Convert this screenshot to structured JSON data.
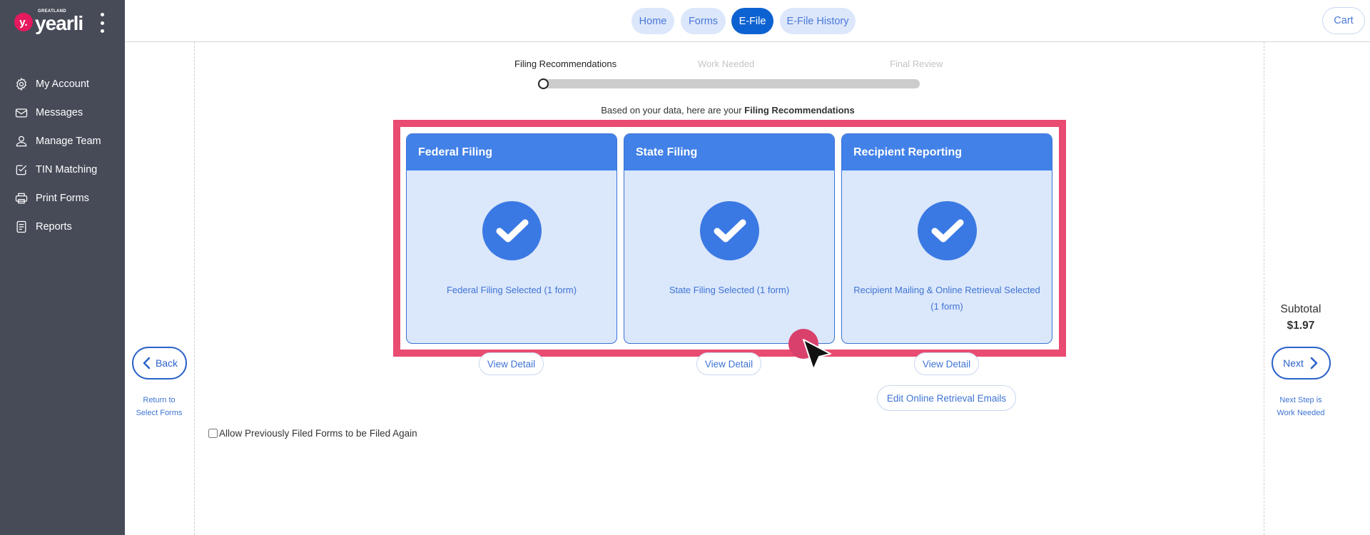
{
  "app": {
    "logo_mark": "y.",
    "logo_brand": "GREATLAND",
    "logo_text": "yearli"
  },
  "sidebar": {
    "items": [
      {
        "label": "My Account",
        "icon": "gear-icon"
      },
      {
        "label": "Messages",
        "icon": "envelope-icon"
      },
      {
        "label": "Manage Team",
        "icon": "user-icon"
      },
      {
        "label": "TIN Matching",
        "icon": "checkbox-icon"
      },
      {
        "label": "Print Forms",
        "icon": "printer-icon"
      },
      {
        "label": "Reports",
        "icon": "document-icon"
      }
    ]
  },
  "header": {
    "tabs": [
      {
        "label": "Home",
        "active": false
      },
      {
        "label": "Forms",
        "active": false
      },
      {
        "label": "E-File",
        "active": true
      },
      {
        "label": "E-File History",
        "active": false
      }
    ],
    "cart_label": "Cart"
  },
  "stepper": {
    "steps": [
      "Filing Recommendations",
      "Work Needed",
      "Final Review"
    ],
    "current_step": 1,
    "step_count": 3
  },
  "intro": {
    "prefix": "Based on your data, here are your ",
    "emphasis": "Filing Recommendations"
  },
  "cards": [
    {
      "title": "Federal Filing",
      "status": "Federal Filing Selected (1 form)",
      "detail_label": "View Detail"
    },
    {
      "title": "State Filing",
      "status": "State Filing Selected (1 form)",
      "detail_label": "View Detail"
    },
    {
      "title": "Recipient Reporting",
      "status": "Recipient Mailing & Online Retrieval Selected (1 form)",
      "detail_label": "View Detail",
      "extra_label": "Edit Online Retrieval Emails"
    }
  ],
  "nav": {
    "back_label": "Back",
    "back_note_line1": "Return to",
    "back_note_line2": "Select Forms",
    "next_label": "Next",
    "next_note_line1": "Next Step is",
    "next_note_line2": "Work Needed"
  },
  "summary": {
    "subtotal_label": "Subtotal",
    "subtotal_value": "$1.97"
  },
  "options": {
    "allow_refile_label": "Allow Previously Filed Forms to be Filed Again",
    "allow_refile_checked": false
  },
  "colors": {
    "sidebar_bg": "#474b58",
    "accent": "#0d62d1",
    "card_header": "#4281e8",
    "card_body": "#dbe7fb",
    "highlight": "#e94b71",
    "logo": "#e5195d"
  }
}
